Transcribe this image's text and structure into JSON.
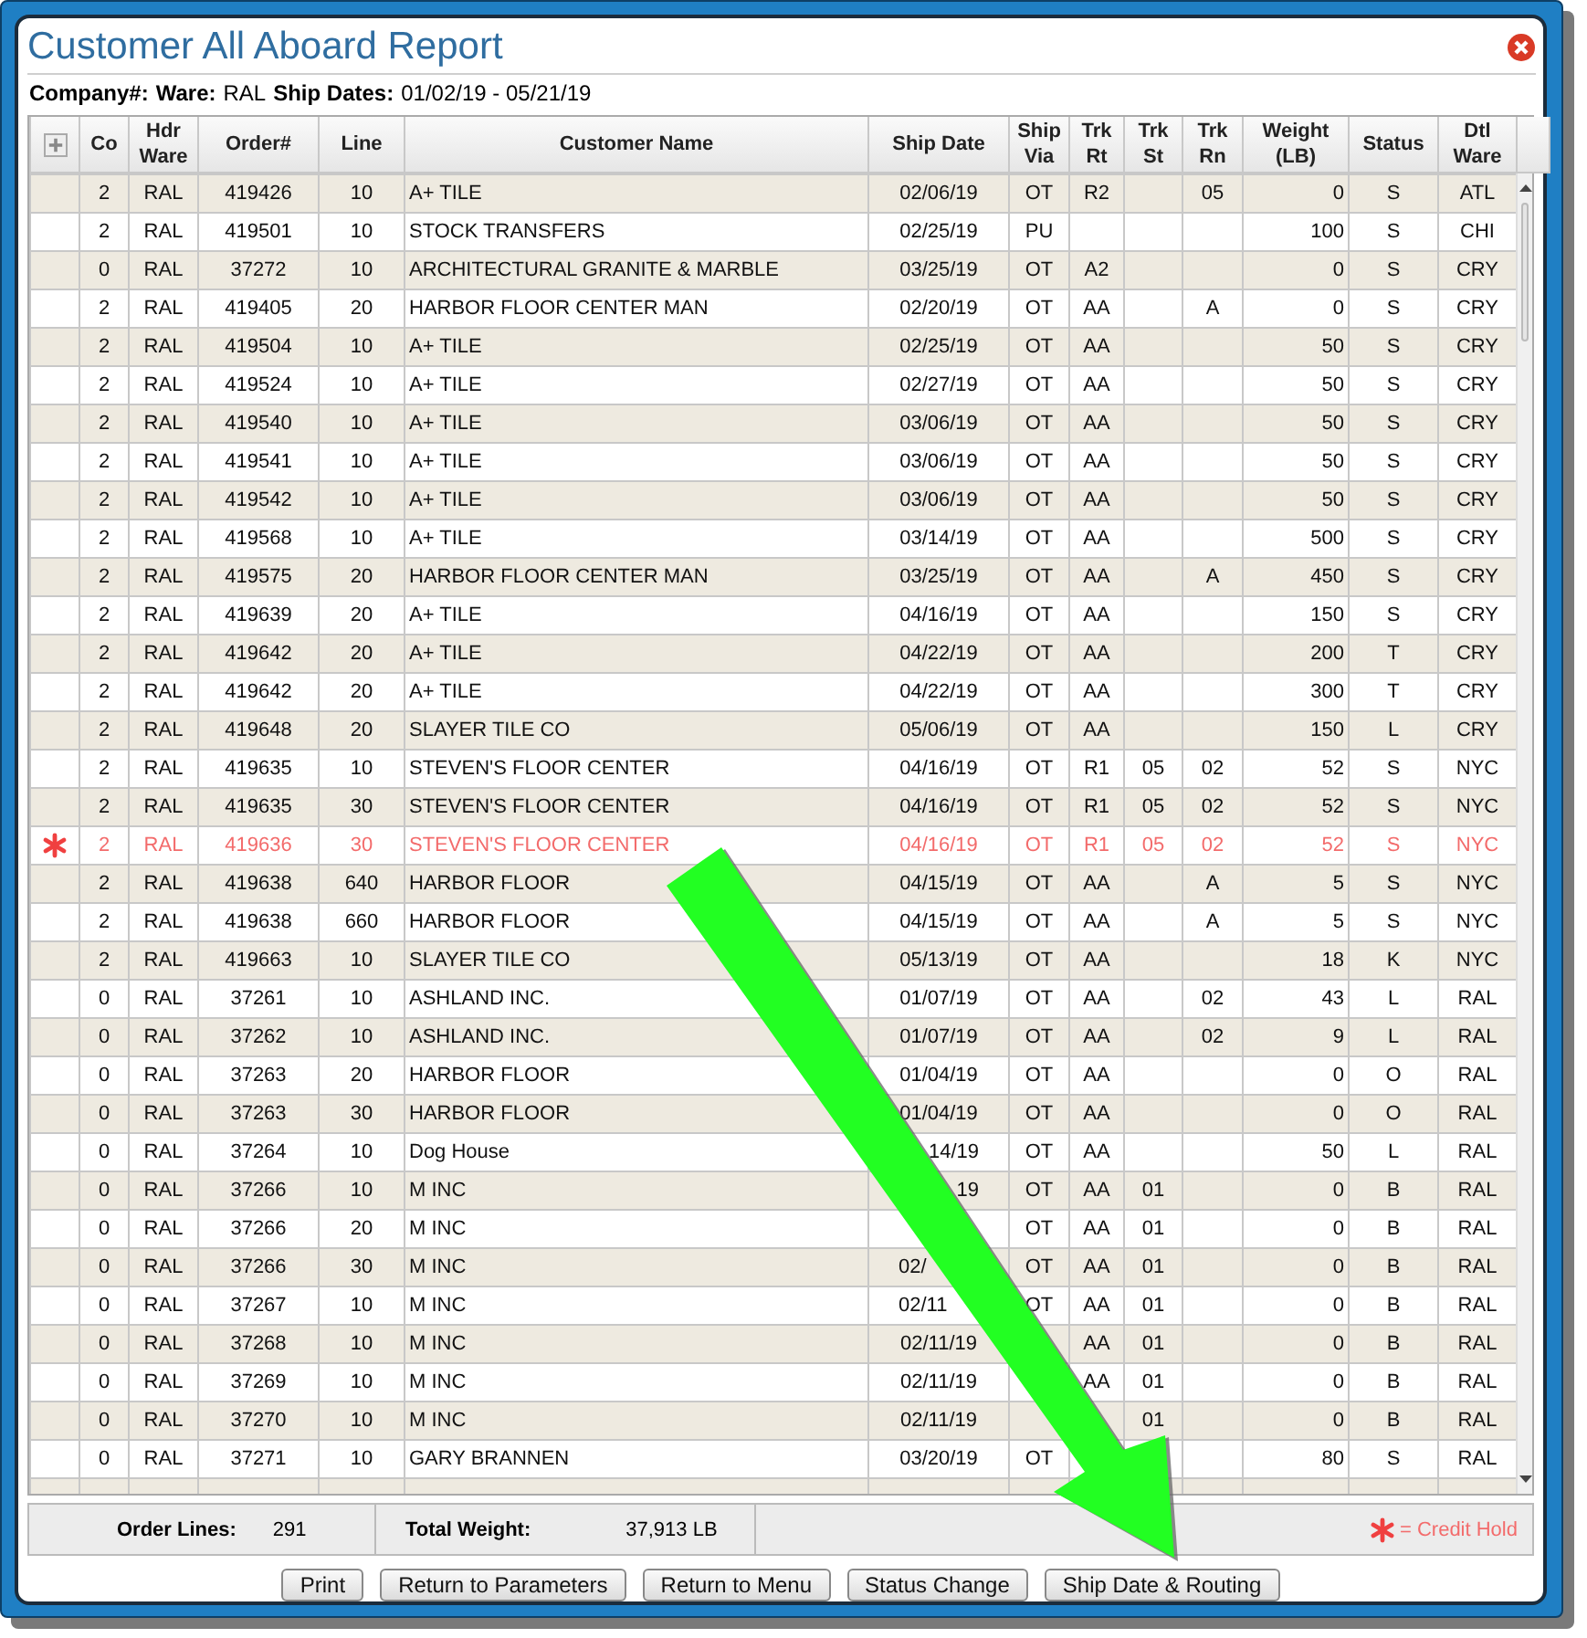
{
  "window": {
    "title": "Customer All Aboard Report"
  },
  "criteria": [
    {
      "label": "Company#:"
    },
    {
      "label": "Ware:",
      "value": "RAL"
    },
    {
      "label": "Ship Dates:",
      "value": "01/02/19 - 05/21/19"
    }
  ],
  "table": {
    "columns": [
      {
        "label": "Co"
      },
      {
        "label": "Hdr Ware"
      },
      {
        "label": "Order#"
      },
      {
        "label": "Line"
      },
      {
        "label": "Customer Name"
      },
      {
        "label": "Ship Date"
      },
      {
        "label": "Ship Via"
      },
      {
        "label": "Trk Rt"
      },
      {
        "label": "Trk St"
      },
      {
        "label": "Trk Rn"
      },
      {
        "label": "Weight (LB)"
      },
      {
        "label": "Status"
      },
      {
        "label": "Dtl Ware"
      }
    ],
    "rows": [
      {
        "kind": "full",
        "credit_hold": false,
        "co": "2",
        "hw": "RAL",
        "ord": "419426",
        "ln": "10",
        "cust": "A+ TILE",
        "date": "02/06/19",
        "via": "OT",
        "rt": "R2",
        "rn": "05",
        "wt": "0",
        "stat": "S",
        "dtl": "ATL"
      },
      {
        "kind": "full",
        "credit_hold": false,
        "co": "2",
        "hw": "RAL",
        "ord": "419501",
        "ln": "10",
        "cust": "STOCK TRANSFERS",
        "date": "02/25/19",
        "via": "PU",
        "wt": "100",
        "stat": "S",
        "dtl": "CHI"
      },
      {
        "kind": "full",
        "credit_hold": false,
        "co": "0",
        "hw": "RAL",
        "ord": "37272",
        "ln": "10",
        "cust": "ARCHITECTURAL GRANITE & MARBLE",
        "date": "03/25/19",
        "via": "OT",
        "rt": "A2",
        "wt": "0",
        "stat": "S",
        "dtl": "CRY"
      },
      {
        "kind": "full",
        "credit_hold": false,
        "co": "2",
        "hw": "RAL",
        "ord": "419405",
        "ln": "20",
        "cust": "HARBOR FLOOR CENTER MAN",
        "date": "02/20/19",
        "via": "OT",
        "rt": "AA",
        "rn": "A",
        "wt": "0",
        "stat": "S",
        "dtl": "CRY"
      },
      {
        "kind": "full",
        "credit_hold": false,
        "co": "2",
        "hw": "RAL",
        "ord": "419504",
        "ln": "10",
        "cust": "A+ TILE",
        "date": "02/25/19",
        "via": "OT",
        "rt": "AA",
        "wt": "50",
        "stat": "S",
        "dtl": "CRY"
      },
      {
        "kind": "full",
        "credit_hold": false,
        "co": "2",
        "hw": "RAL",
        "ord": "419524",
        "ln": "10",
        "cust": "A+ TILE",
        "date": "02/27/19",
        "via": "OT",
        "rt": "AA",
        "wt": "50",
        "stat": "S",
        "dtl": "CRY"
      },
      {
        "kind": "full",
        "credit_hold": false,
        "co": "2",
        "hw": "RAL",
        "ord": "419540",
        "ln": "10",
        "cust": "A+ TILE",
        "date": "03/06/19",
        "via": "OT",
        "rt": "AA",
        "wt": "50",
        "stat": "S",
        "dtl": "CRY"
      },
      {
        "kind": "full",
        "credit_hold": false,
        "co": "2",
        "hw": "RAL",
        "ord": "419541",
        "ln": "10",
        "cust": "A+ TILE",
        "date": "03/06/19",
        "via": "OT",
        "rt": "AA",
        "wt": "50",
        "stat": "S",
        "dtl": "CRY"
      },
      {
        "kind": "full",
        "credit_hold": false,
        "co": "2",
        "hw": "RAL",
        "ord": "419542",
        "ln": "10",
        "cust": "A+ TILE",
        "date": "03/06/19",
        "via": "OT",
        "rt": "AA",
        "wt": "50",
        "stat": "S",
        "dtl": "CRY"
      },
      {
        "kind": "full",
        "credit_hold": false,
        "co": "2",
        "hw": "RAL",
        "ord": "419568",
        "ln": "10",
        "cust": "A+ TILE",
        "date": "03/14/19",
        "via": "OT",
        "rt": "AA",
        "wt": "500",
        "stat": "S",
        "dtl": "CRY"
      },
      {
        "kind": "full",
        "credit_hold": false,
        "co": "2",
        "hw": "RAL",
        "ord": "419575",
        "ln": "20",
        "cust": "HARBOR FLOOR CENTER MAN",
        "date": "03/25/19",
        "via": "OT",
        "rt": "AA",
        "rn": "A",
        "wt": "450",
        "stat": "S",
        "dtl": "CRY"
      },
      {
        "kind": "full",
        "credit_hold": false,
        "co": "2",
        "hw": "RAL",
        "ord": "419639",
        "ln": "20",
        "cust": "A+ TILE",
        "date": "04/16/19",
        "via": "OT",
        "rt": "AA",
        "wt": "150",
        "stat": "S",
        "dtl": "CRY"
      },
      {
        "kind": "full",
        "credit_hold": false,
        "co": "2",
        "hw": "RAL",
        "ord": "419642",
        "ln": "20",
        "cust": "A+ TILE",
        "date": "04/22/19",
        "via": "OT",
        "rt": "AA",
        "wt": "200",
        "stat": "T",
        "dtl": "CRY"
      },
      {
        "kind": "full",
        "credit_hold": false,
        "co": "2",
        "hw": "RAL",
        "ord": "419642",
        "ln": "20",
        "cust": "A+ TILE",
        "date": "04/22/19",
        "via": "OT",
        "rt": "AA",
        "wt": "300",
        "stat": "T",
        "dtl": "CRY"
      },
      {
        "kind": "full",
        "credit_hold": false,
        "co": "2",
        "hw": "RAL",
        "ord": "419648",
        "ln": "20",
        "cust": "SLAYER TILE CO",
        "date": "05/06/19",
        "via": "OT",
        "rt": "AA",
        "wt": "150",
        "stat": "L",
        "dtl": "CRY"
      },
      {
        "kind": "full",
        "credit_hold": false,
        "co": "2",
        "hw": "RAL",
        "ord": "419635",
        "ln": "10",
        "cust": "STEVEN'S FLOOR CENTER",
        "date": "04/16/19",
        "via": "OT",
        "rt": "R1",
        "st": "05",
        "rn": "02",
        "wt": "52",
        "stat": "S",
        "dtl": "NYC"
      },
      {
        "kind": "full",
        "credit_hold": false,
        "co": "2",
        "hw": "RAL",
        "ord": "419635",
        "ln": "30",
        "cust": "STEVEN'S FLOOR CENTER",
        "date": "04/16/19",
        "via": "OT",
        "rt": "R1",
        "st": "05",
        "rn": "02",
        "wt": "52",
        "stat": "S",
        "dtl": "NYC"
      },
      {
        "kind": "full",
        "credit_hold": true,
        "co": "2",
        "hw": "RAL",
        "ord": "419636",
        "ln": "30",
        "cust": "STEVEN'S FLOOR CENTER",
        "date": "04/16/19",
        "via": "OT",
        "rt": "R1",
        "st": "05",
        "rn": "02",
        "wt": "52",
        "stat": "S",
        "dtl": "NYC"
      },
      {
        "kind": "full",
        "credit_hold": false,
        "co": "2",
        "hw": "RAL",
        "ord": "419638",
        "ln": "640",
        "cust": "HARBOR FLOOR",
        "date": "04/15/19",
        "via": "OT",
        "rt": "AA",
        "rn": "A",
        "wt": "5",
        "stat": "S",
        "dtl": "NYC"
      },
      {
        "kind": "full",
        "credit_hold": false,
        "co": "2",
        "hw": "RAL",
        "ord": "419638",
        "ln": "660",
        "cust": "HARBOR FLOOR",
        "date": "04/15/19",
        "via": "OT",
        "rt": "AA",
        "rn": "A",
        "wt": "5",
        "stat": "S",
        "dtl": "NYC"
      },
      {
        "kind": "full",
        "credit_hold": false,
        "co": "2",
        "hw": "RAL",
        "ord": "419663",
        "ln": "10",
        "cust": "SLAYER TILE CO",
        "date": "05/13/19",
        "via": "OT",
        "rt": "AA",
        "wt": "18",
        "stat": "K",
        "dtl": "NYC"
      },
      {
        "kind": "full",
        "credit_hold": false,
        "co": "0",
        "hw": "RAL",
        "ord": "37261",
        "ln": "10",
        "cust": "ASHLAND INC.",
        "date": "01/07/19",
        "via": "OT",
        "rt": "AA",
        "rn": "02",
        "wt": "43",
        "stat": "L",
        "dtl": "RAL"
      },
      {
        "kind": "full",
        "credit_hold": false,
        "co": "0",
        "hw": "RAL",
        "ord": "37262",
        "ln": "10",
        "cust": "ASHLAND INC.",
        "date": "01/07/19",
        "via": "OT",
        "rt": "AA",
        "rn": "02",
        "wt": "9",
        "stat": "L",
        "dtl": "RAL"
      },
      {
        "kind": "full",
        "credit_hold": false,
        "co": "0",
        "hw": "RAL",
        "ord": "37263",
        "ln": "20",
        "cust": "HARBOR FLOOR",
        "date": "01/04/19",
        "via": "OT",
        "rt": "AA",
        "wt": "0",
        "stat": "O",
        "dtl": "RAL"
      },
      {
        "kind": "full",
        "credit_hold": false,
        "co": "0",
        "hw": "RAL",
        "ord": "37263",
        "ln": "30",
        "cust": "HARBOR FLOOR",
        "date": "01/04/19",
        "via": "OT",
        "rt": "AA",
        "wt": "0",
        "stat": "O",
        "dtl": "RAL"
      },
      {
        "kind": "tail",
        "credit_hold": false,
        "co": "0",
        "hw": "RAL",
        "ord": "37264",
        "ln": "10",
        "cust": "Dog House",
        "date": "14/19",
        "via": "OT",
        "rt": "AA",
        "wt": "50",
        "stat": "L",
        "dtl": "RAL"
      },
      {
        "kind": "tail",
        "credit_hold": false,
        "co": "0",
        "hw": "RAL",
        "ord": "37266",
        "ln": "10",
        "cust": "M INC",
        "date": "19",
        "via": "OT",
        "rt": "AA",
        "st": "01",
        "wt": "0",
        "stat": "B",
        "dtl": "RAL"
      },
      {
        "kind": "full",
        "credit_hold": false,
        "co": "0",
        "hw": "RAL",
        "ord": "37266",
        "ln": "20",
        "cust": "M INC",
        "via": "OT",
        "rt": "AA",
        "st": "01",
        "wt": "0",
        "stat": "B",
        "dtl": "RAL"
      },
      {
        "kind": "head",
        "credit_hold": false,
        "co": "0",
        "hw": "RAL",
        "ord": "37266",
        "ln": "30",
        "cust": "M INC",
        "date": "02/",
        "via": "OT",
        "rt": "AA",
        "st": "01",
        "wt": "0",
        "stat": "B",
        "dtl": "RAL"
      },
      {
        "kind": "head",
        "credit_hold": false,
        "co": "0",
        "hw": "RAL",
        "ord": "37267",
        "ln": "10",
        "cust": "M INC",
        "date": "02/11",
        "via": "OT",
        "rt": "AA",
        "st": "01",
        "wt": "0",
        "stat": "B",
        "dtl": "RAL"
      },
      {
        "kind": "full",
        "credit_hold": false,
        "co": "0",
        "hw": "RAL",
        "ord": "37268",
        "ln": "10",
        "cust": "M INC",
        "date": "02/11/19",
        "rt": "AA",
        "st": "01",
        "wt": "0",
        "stat": "B",
        "dtl": "RAL"
      },
      {
        "kind": "full",
        "credit_hold": false,
        "co": "0",
        "hw": "RAL",
        "ord": "37269",
        "ln": "10",
        "cust": "M INC",
        "date": "02/11/19",
        "rt": "AA",
        "st": "01",
        "wt": "0",
        "stat": "B",
        "dtl": "RAL"
      },
      {
        "kind": "full",
        "credit_hold": false,
        "co": "0",
        "hw": "RAL",
        "ord": "37270",
        "ln": "10",
        "cust": "M INC",
        "date": "02/11/19",
        "st": "01",
        "wt": "0",
        "stat": "B",
        "dtl": "RAL"
      },
      {
        "kind": "full",
        "credit_hold": false,
        "co": "0",
        "hw": "RAL",
        "ord": "37271",
        "ln": "10",
        "cust": "GARY BRANNEN",
        "date": "03/20/19",
        "via": "OT",
        "wt": "80",
        "stat": "S",
        "dtl": "RAL"
      }
    ]
  },
  "summary": {
    "order_lines_label": "Order Lines:",
    "order_lines": "291",
    "total_weight_label": "Total Weight:",
    "total_weight": "37,913 LB",
    "legend": "= Credit Hold"
  },
  "buttons": [
    "Print",
    "Return to Parameters",
    "Return to Menu",
    "Status Change",
    "Ship Date & Routing"
  ]
}
